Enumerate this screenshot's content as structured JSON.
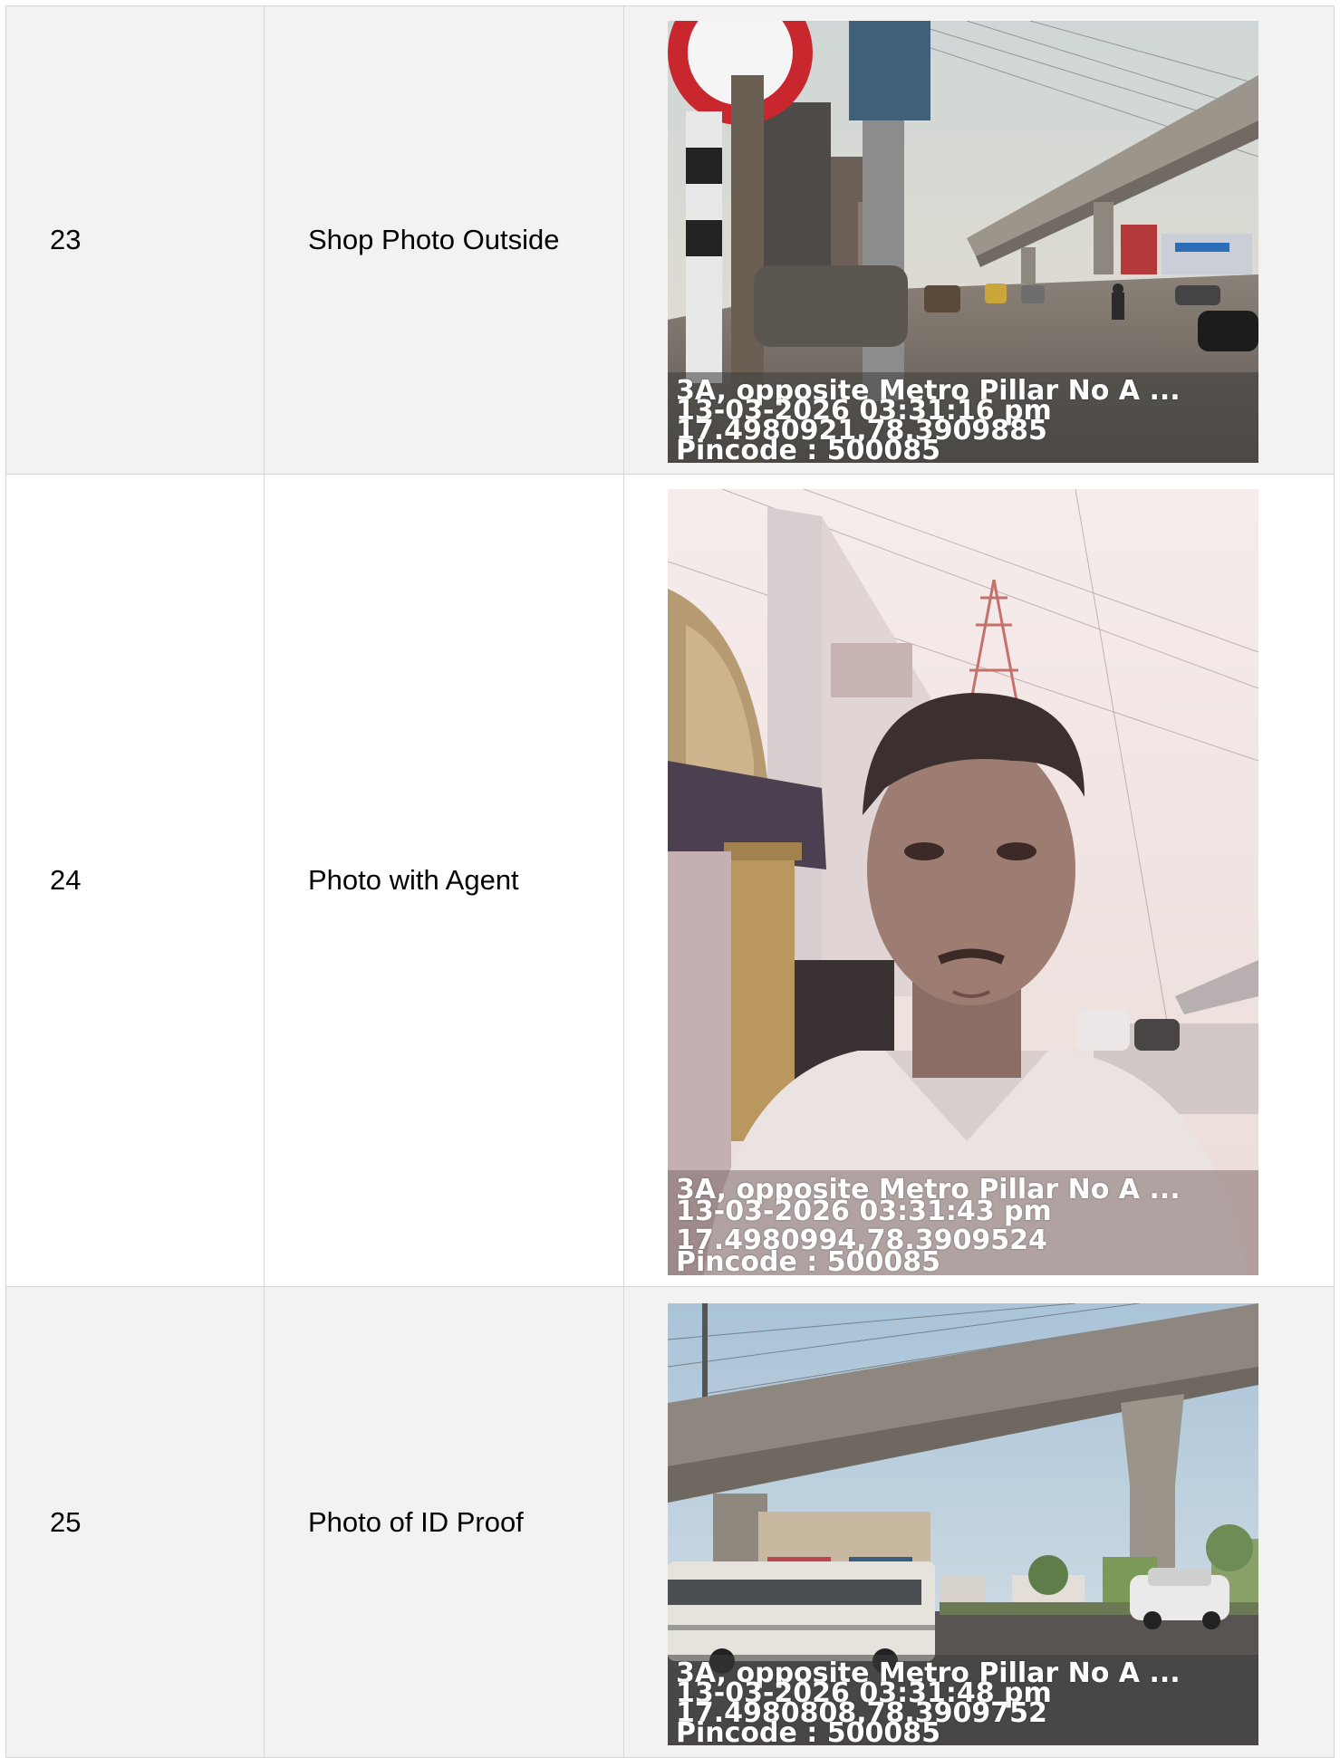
{
  "rows": [
    {
      "index": "23",
      "label": "Shop Photo Outside",
      "photo_subject": "street-with-metro-viaduct",
      "stamp": {
        "address": "3A, opposite Metro Pillar No A ...",
        "datetime": "13-03-2026 03:31:16 pm",
        "coords": "17.4980921,78.3909885",
        "pincode": "Pincode : 500085"
      }
    },
    {
      "index": "24",
      "label": "Photo with Agent",
      "photo_subject": "selfie-of-agent",
      "stamp": {
        "address": "3A, opposite Metro Pillar No A ...",
        "datetime": "13-03-2026 03:31:43 pm",
        "coords": "17.4980994,78.3909524",
        "pincode": "Pincode : 500085"
      }
    },
    {
      "index": "25",
      "label": "Photo of ID Proof",
      "photo_subject": "metro-viaduct-with-bus",
      "stamp": {
        "address": "3A, opposite Metro Pillar No A ...",
        "datetime": "13-03-2026 03:31:48 pm",
        "coords": "17.4980808,78.3909752",
        "pincode": "Pincode : 500085"
      }
    }
  ]
}
